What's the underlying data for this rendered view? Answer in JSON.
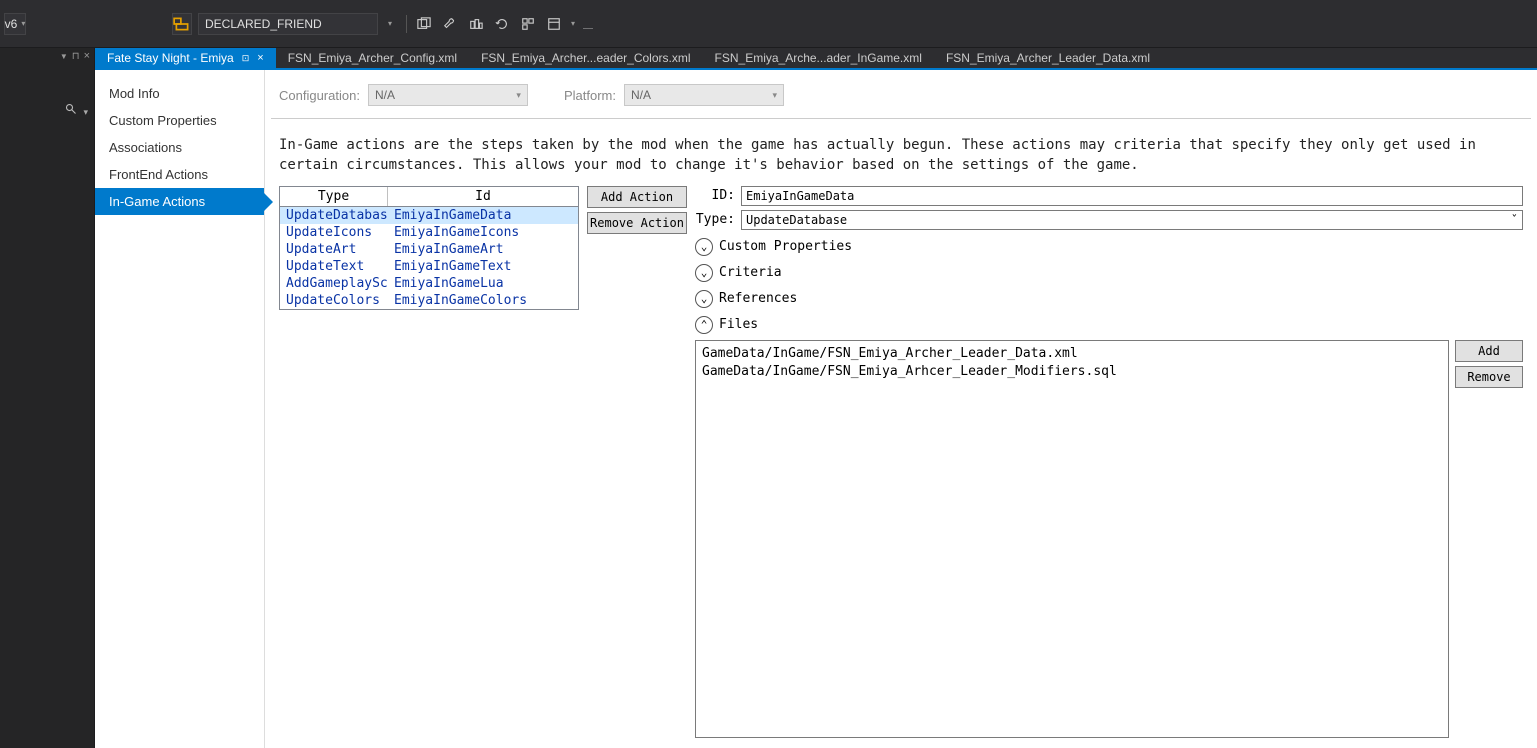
{
  "toolbar": {
    "left_text": "v6",
    "search_text": "DECLARED_FRIEND"
  },
  "leftpanel": {
    "pin": "⟂",
    "close": "×"
  },
  "tabs": [
    {
      "label": "Fate Stay Night - Emiya",
      "active": true,
      "pinned": true
    },
    {
      "label": "FSN_Emiya_Archer_Config.xml",
      "active": false
    },
    {
      "label": "FSN_Emiya_Archer...eader_Colors.xml",
      "active": false
    },
    {
      "label": "FSN_Emiya_Arche...ader_InGame.xml",
      "active": false
    },
    {
      "label": "FSN_Emiya_Archer_Leader_Data.xml",
      "active": false
    }
  ],
  "sidenav": [
    {
      "label": "Mod Info"
    },
    {
      "label": "Custom Properties"
    },
    {
      "label": "Associations"
    },
    {
      "label": "FrontEnd Actions"
    },
    {
      "label": "In-Game Actions",
      "active": true
    }
  ],
  "config": {
    "config_label": "Configuration:",
    "config_value": "N/A",
    "platform_label": "Platform:",
    "platform_value": "N/A"
  },
  "description": "In-Game actions are the steps taken by the mod when the game has actually begun.  These actions may criteria that specify they only get used in certain circumstances.  This allows your mod to change it's behavior based on the settings of the game.",
  "table": {
    "col1": "Type",
    "col2": "Id",
    "rows": [
      {
        "type": "UpdateDatabase",
        "id": "EmiyaInGameData",
        "selected": true
      },
      {
        "type": "UpdateIcons",
        "id": "EmiyaInGameIcons"
      },
      {
        "type": "UpdateArt",
        "id": "EmiyaInGameArt"
      },
      {
        "type": "UpdateText",
        "id": "EmiyaInGameText"
      },
      {
        "type": "AddGameplayScri",
        "id": "EmiyaInGameLua"
      },
      {
        "type": "UpdateColors",
        "id": "EmiyaInGameColors"
      }
    ]
  },
  "buttons": {
    "add_action": "Add Action",
    "remove_action": "Remove Action",
    "add": "Add",
    "remove": "Remove"
  },
  "detail": {
    "id_label": "ID:",
    "id_value": "EmiyaInGameData",
    "type_label": "Type:",
    "type_value": "UpdateDatabase",
    "exp_custom": "Custom Properties",
    "exp_criteria": "Criteria",
    "exp_references": "References",
    "exp_files": "Files",
    "files": [
      "GameData/InGame/FSN_Emiya_Archer_Leader_Data.xml",
      "GameData/InGame/FSN_Emiya_Arhcer_Leader_Modifiers.sql"
    ]
  }
}
